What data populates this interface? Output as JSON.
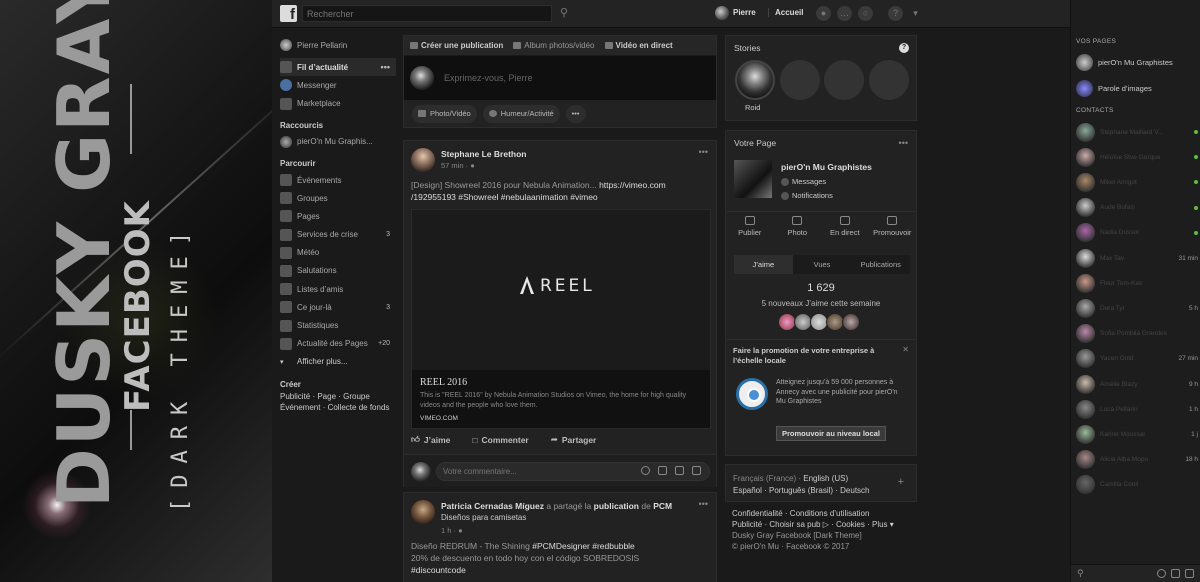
{
  "brand": {
    "title_main": "DUSKY GRAY",
    "title_sub": "FACEBOOK",
    "title_theme": "[DARK THEME]"
  },
  "topbar": {
    "search_placeholder": "Rechercher",
    "profile_name": "Pierre",
    "home_label": "Accueil",
    "logo_letter": "f"
  },
  "leftnav": {
    "profile_name": "Pierre Pellarin",
    "main_items": [
      {
        "label": "Fil d’actualité",
        "icon": "news-feed-icon",
        "active": true
      },
      {
        "label": "Messenger",
        "icon": "messenger-icon"
      },
      {
        "label": "Marketplace",
        "icon": "marketplace-icon"
      }
    ],
    "shortcuts_title": "Raccourcis",
    "shortcuts": [
      {
        "label": "pierO'n Mu Graphis..."
      }
    ],
    "explore_title": "Parcourir",
    "explore": [
      {
        "label": "Événements",
        "icon": "calendar-icon",
        "count": ""
      },
      {
        "label": "Groupes",
        "icon": "groups-icon",
        "count": ""
      },
      {
        "label": "Pages",
        "icon": "flag-icon",
        "count": ""
      },
      {
        "label": "Services de crise",
        "icon": "crisis-icon",
        "count": "3"
      },
      {
        "label": "Météo",
        "icon": "weather-icon",
        "count": ""
      },
      {
        "label": "Salutations",
        "icon": "wave-icon",
        "count": ""
      },
      {
        "label": "Listes d’amis",
        "icon": "friends-list-icon",
        "count": ""
      },
      {
        "label": "Ce jour-là",
        "icon": "memories-icon",
        "count": "3"
      },
      {
        "label": "Statistiques",
        "icon": "stats-icon",
        "count": ""
      },
      {
        "label": "Actualité des Pages",
        "icon": "pages-feed-icon",
        "count": "+20"
      }
    ],
    "see_more": "Afficher plus...",
    "create_title": "Créer",
    "create_line1": "Publicité · Page · Groupe",
    "create_line2": "Événement · Collecte de fonds"
  },
  "composer": {
    "tabs": [
      "Créer une publication",
      "Album photos/vidéo",
      "Vidéo en direct"
    ],
    "prompt": "Exprimez-vous, Pierre",
    "actions": [
      "Photo/Vidéo",
      "Humeur/Activité",
      "•••"
    ]
  },
  "post1": {
    "author": "Stephane Le Brethon",
    "time": "57 min",
    "text_line1": "[Design] Showreel 2016 pour Nebula Animation... ",
    "link": "https://vimeo.com",
    "text_line2": "/192955193 #Showreel #nebulaanimation #vimeo",
    "media_logo": "REEL",
    "link_title": "REEL 2016",
    "link_desc": "This is \"REEL 2016\" by Nebula Animation Studios on Vimeo, the home for high quality videos and the people who love them.",
    "link_domain": "VIMEO.COM",
    "actions": [
      "J’aime",
      "Commenter",
      "Partager"
    ],
    "comment_placeholder": "Votre commentaire..."
  },
  "post2": {
    "author": "Patricia Cernadas Míguez",
    "shared_text": "a partagé la",
    "shared_target": "publication",
    "of_text": "de",
    "page": "PCM",
    "subtitle": "Diseños para camisetas",
    "time": "1 h",
    "text_line1": "Diseño REDRUM - The Shining ",
    "text_tags1": "#PCMDesigner #redbubble",
    "text_line2": "20% de descuento en todo hoy con el código SOBREDOSIS",
    "text_tags2": "#discountcode"
  },
  "stories": {
    "title": "Stories",
    "first_label": "Roid"
  },
  "yourpage": {
    "title": "Votre Page",
    "page_name": "pierO'n Mu Graphistes",
    "messages": "Messages",
    "notifications": "Notifications",
    "actions": [
      "Publier",
      "Photo",
      "En direct",
      "Promouvoir"
    ],
    "tabs": [
      "J’aime",
      "Vues",
      "Publications"
    ],
    "likes_count": "1 629",
    "likes_week": "5 nouveaux J’aime cette semaine",
    "promo_title": "Faire la promotion de votre entreprise à l’échelle locale",
    "promo_text": "Atteignez jusqu’à 59 000 personnes à Annecy avec une publicité pour pierO'n Mu Graphistes",
    "promo_button": "Promouvoir au niveau local"
  },
  "langs": {
    "current": "Français (France)",
    "sep": " · ",
    "alt": "English (US)",
    "list": "Español · Português (Brasil) · Deutsch",
    "plus": "+"
  },
  "footer": {
    "line1": "Confidentialité · Conditions d’utilisation",
    "line2": "Publicité · Choisir sa pub ▷ · Cookies · Plus ▾",
    "line3": "Dusky Gray Facebook [Dark Theme]",
    "line4": "© pierO'n Mu · Facebook © 2017"
  },
  "chat": {
    "pages_title": "VOS PAGES",
    "pages": [
      "pierO'n Mu Graphistes",
      "Parole d’images"
    ],
    "contacts_title": "CONTACTS",
    "contacts": [
      {
        "name": "Stéphane Maillard V...",
        "status": "online"
      },
      {
        "name": "Héloïse Stve Gorque",
        "status": "online"
      },
      {
        "name": "Mikel Amigot",
        "status": "online"
      },
      {
        "name": "Aude Bufais",
        "status": "online"
      },
      {
        "name": "Nadia Dussol",
        "status": "online"
      },
      {
        "name": "Max Tav",
        "status": "31 min"
      },
      {
        "name": "Fleur Tom-Kas",
        "status": ""
      },
      {
        "name": "Dora Tyr",
        "status": "5 h"
      },
      {
        "name": "Sofia Pombila Grandes",
        "status": ""
      },
      {
        "name": "Yacen Gold",
        "status": "27 min"
      },
      {
        "name": "Amélie Blazy",
        "status": "9 h"
      },
      {
        "name": "Luca Pellarin",
        "status": "1 h"
      },
      {
        "name": "Karine Moussal",
        "status": "1 j"
      },
      {
        "name": "Alicia Alba Mopo",
        "status": "18 h"
      },
      {
        "name": "Camilla Conil",
        "status": ""
      }
    ]
  },
  "colors": {
    "background": "#1a1a1a",
    "card": "#222222",
    "online": "#5fbf3c",
    "promo_blue": "#2a6fa8"
  }
}
